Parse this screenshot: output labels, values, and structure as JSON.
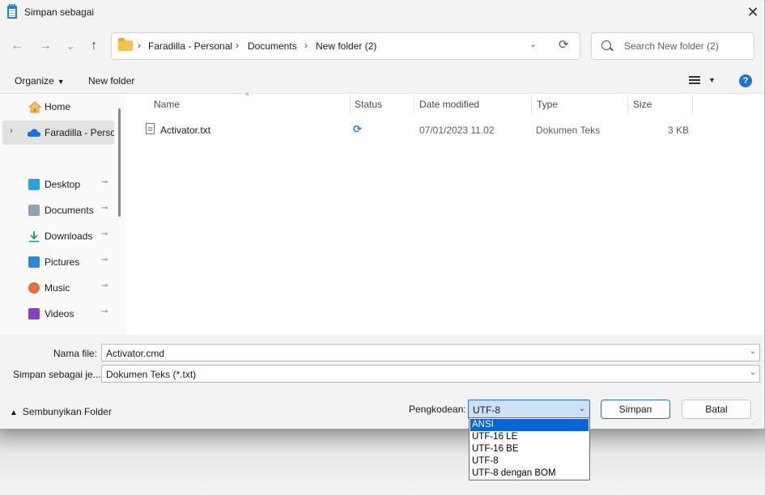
{
  "window": {
    "title": "Simpan sebagai",
    "close_glyph": "✕"
  },
  "nav": {
    "back": "←",
    "forward": "→",
    "recent": "⌄",
    "up": "↑"
  },
  "address": {
    "breadcrumbs": [
      "Faradilla - Personal",
      "Documents",
      "New folder (2)"
    ],
    "separator": "›",
    "dropdown_glyph": "⌄",
    "refresh_glyph": "⟳"
  },
  "search": {
    "placeholder": "Search New folder (2)"
  },
  "toolbar": {
    "organize": "Organize",
    "new_folder": "New folder",
    "help": "?"
  },
  "sidebar": {
    "items": [
      {
        "label": "Home",
        "icon": "home-icon"
      },
      {
        "label": "Faradilla - Perso",
        "icon": "onedrive-icon",
        "selected": true,
        "chevron": "›"
      },
      {
        "label": "Desktop",
        "icon": "desktop-icon",
        "pinned": true
      },
      {
        "label": "Documents",
        "icon": "documents-icon",
        "pinned": true
      },
      {
        "label": "Downloads",
        "icon": "downloads-icon",
        "pinned": true
      },
      {
        "label": "Pictures",
        "icon": "pictures-icon",
        "pinned": true
      },
      {
        "label": "Music",
        "icon": "music-icon",
        "pinned": true
      },
      {
        "label": "Videos",
        "icon": "videos-icon",
        "pinned": true
      }
    ],
    "pin_glyph": "📌"
  },
  "files": {
    "columns": [
      "Name",
      "Status",
      "Date modified",
      "Type",
      "Size"
    ],
    "sort_glyph": "^",
    "rows": [
      {
        "name": "Activator.txt",
        "status_icon": "sync-icon",
        "date": "07/01/2023 11.02",
        "type": "Dokumen Teks",
        "size": "3 KB"
      }
    ]
  },
  "form": {
    "filename_label": "Nama file:",
    "filename_value": "Activator.cmd",
    "savetype_label": "Simpan sebagai je...",
    "savetype_value": "Dokumen Teks (*.txt)"
  },
  "footer": {
    "hide_folders": "Sembunyikan Folder",
    "encoding_label": "Pengkodean:",
    "encoding_value": "UTF-8",
    "save_button": "Simpan",
    "cancel_button": "Batal"
  },
  "encoding_options": [
    {
      "label": "ANSI",
      "highlighted": true
    },
    {
      "label": "UTF-16 LE"
    },
    {
      "label": "UTF-16 BE"
    },
    {
      "label": "UTF-8"
    },
    {
      "label": "UTF-8 dengan BOM"
    }
  ],
  "colors": {
    "accent": "#2b6fd6",
    "selection": "#0a64d8",
    "sync": "#1f7ad9"
  }
}
